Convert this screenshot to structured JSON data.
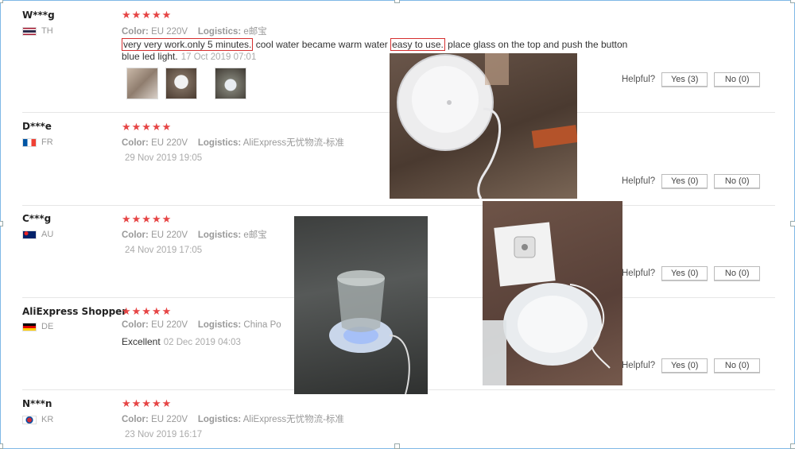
{
  "reviews": [
    {
      "name": "W***g",
      "country": "TH",
      "stars": "★★★★★",
      "color_label": "Color:",
      "color": "EU 220V",
      "logistics_label": "Logistics:",
      "logistics": "e邮宝",
      "text_hl1": "very very work.only 5 minutes.",
      "text_mid": " cool water became warm water ",
      "text_hl2": "easy to use.",
      "text_end": " place glass on the top and push the button",
      "text_line2": "blue led light.",
      "date": "17 Oct 2019 07:01",
      "helpful": "Helpful?",
      "yes": "Yes (3)",
      "no": "No (0)"
    },
    {
      "name": "D***e",
      "country": "FR",
      "stars": "★★★★★",
      "color_label": "Color:",
      "color": "EU 220V",
      "logistics_label": "Logistics:",
      "logistics": "AliExpress无忧物流-标准",
      "date": "29 Nov 2019 19:05",
      "helpful": "Helpful?",
      "yes": "Yes (0)",
      "no": "No (0)"
    },
    {
      "name": "C***g",
      "country": "AU",
      "stars": "★★★★★",
      "color_label": "Color:",
      "color": "EU 220V",
      "logistics_label": "Logistics:",
      "logistics": "e邮宝",
      "date": "24 Nov 2019 17:05",
      "helpful": "Helpful?",
      "yes": "Yes (0)",
      "no": "No (0)"
    },
    {
      "name": "AliExpress Shopper",
      "country": "DE",
      "stars": "★★★★★",
      "color_label": "Color:",
      "color": "EU 220V",
      "logistics_label": "Logistics:",
      "logistics": "China Po",
      "text": "Excellent",
      "date": "02 Dec 2019 04:03",
      "helpful": "Helpful?",
      "yes": "Yes (0)",
      "no": "No (0)"
    },
    {
      "name": "N***n",
      "country": "KR",
      "stars": "★★★★★",
      "color_label": "Color:",
      "color": "EU 220V",
      "logistics_label": "Logistics:",
      "logistics": "AliExpress无忧物流-标准",
      "date": "23 Nov 2019 16:17"
    }
  ],
  "colors": {
    "star": "#e64545",
    "highlight_box": "#d62f2f",
    "frame": "#7fb8e6"
  },
  "icons": {
    "flag_th": "thailand-flag-icon",
    "flag_fr": "france-flag-icon",
    "flag_au": "australia-flag-icon",
    "flag_de": "germany-flag-icon",
    "flag_kr": "korea-flag-icon"
  }
}
